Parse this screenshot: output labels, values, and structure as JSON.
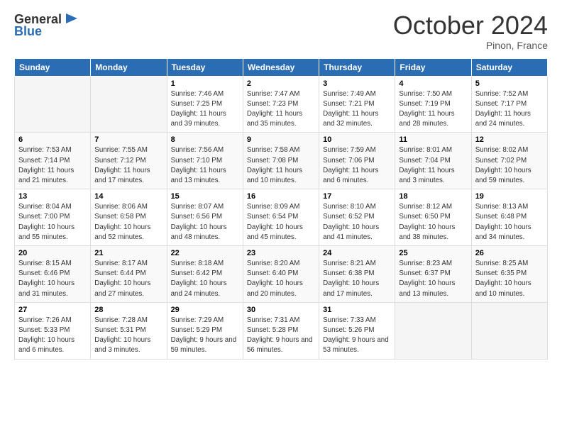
{
  "header": {
    "logo_general": "General",
    "logo_blue": "Blue",
    "month_title": "October 2024",
    "location": "Pinon, France"
  },
  "days_of_week": [
    "Sunday",
    "Monday",
    "Tuesday",
    "Wednesday",
    "Thursday",
    "Friday",
    "Saturday"
  ],
  "weeks": [
    [
      {
        "day": "",
        "info": ""
      },
      {
        "day": "",
        "info": ""
      },
      {
        "day": "1",
        "info": "Sunrise: 7:46 AM\nSunset: 7:25 PM\nDaylight: 11 hours and 39 minutes."
      },
      {
        "day": "2",
        "info": "Sunrise: 7:47 AM\nSunset: 7:23 PM\nDaylight: 11 hours and 35 minutes."
      },
      {
        "day": "3",
        "info": "Sunrise: 7:49 AM\nSunset: 7:21 PM\nDaylight: 11 hours and 32 minutes."
      },
      {
        "day": "4",
        "info": "Sunrise: 7:50 AM\nSunset: 7:19 PM\nDaylight: 11 hours and 28 minutes."
      },
      {
        "day": "5",
        "info": "Sunrise: 7:52 AM\nSunset: 7:17 PM\nDaylight: 11 hours and 24 minutes."
      }
    ],
    [
      {
        "day": "6",
        "info": "Sunrise: 7:53 AM\nSunset: 7:14 PM\nDaylight: 11 hours and 21 minutes."
      },
      {
        "day": "7",
        "info": "Sunrise: 7:55 AM\nSunset: 7:12 PM\nDaylight: 11 hours and 17 minutes."
      },
      {
        "day": "8",
        "info": "Sunrise: 7:56 AM\nSunset: 7:10 PM\nDaylight: 11 hours and 13 minutes."
      },
      {
        "day": "9",
        "info": "Sunrise: 7:58 AM\nSunset: 7:08 PM\nDaylight: 11 hours and 10 minutes."
      },
      {
        "day": "10",
        "info": "Sunrise: 7:59 AM\nSunset: 7:06 PM\nDaylight: 11 hours and 6 minutes."
      },
      {
        "day": "11",
        "info": "Sunrise: 8:01 AM\nSunset: 7:04 PM\nDaylight: 11 hours and 3 minutes."
      },
      {
        "day": "12",
        "info": "Sunrise: 8:02 AM\nSunset: 7:02 PM\nDaylight: 10 hours and 59 minutes."
      }
    ],
    [
      {
        "day": "13",
        "info": "Sunrise: 8:04 AM\nSunset: 7:00 PM\nDaylight: 10 hours and 55 minutes."
      },
      {
        "day": "14",
        "info": "Sunrise: 8:06 AM\nSunset: 6:58 PM\nDaylight: 10 hours and 52 minutes."
      },
      {
        "day": "15",
        "info": "Sunrise: 8:07 AM\nSunset: 6:56 PM\nDaylight: 10 hours and 48 minutes."
      },
      {
        "day": "16",
        "info": "Sunrise: 8:09 AM\nSunset: 6:54 PM\nDaylight: 10 hours and 45 minutes."
      },
      {
        "day": "17",
        "info": "Sunrise: 8:10 AM\nSunset: 6:52 PM\nDaylight: 10 hours and 41 minutes."
      },
      {
        "day": "18",
        "info": "Sunrise: 8:12 AM\nSunset: 6:50 PM\nDaylight: 10 hours and 38 minutes."
      },
      {
        "day": "19",
        "info": "Sunrise: 8:13 AM\nSunset: 6:48 PM\nDaylight: 10 hours and 34 minutes."
      }
    ],
    [
      {
        "day": "20",
        "info": "Sunrise: 8:15 AM\nSunset: 6:46 PM\nDaylight: 10 hours and 31 minutes."
      },
      {
        "day": "21",
        "info": "Sunrise: 8:17 AM\nSunset: 6:44 PM\nDaylight: 10 hours and 27 minutes."
      },
      {
        "day": "22",
        "info": "Sunrise: 8:18 AM\nSunset: 6:42 PM\nDaylight: 10 hours and 24 minutes."
      },
      {
        "day": "23",
        "info": "Sunrise: 8:20 AM\nSunset: 6:40 PM\nDaylight: 10 hours and 20 minutes."
      },
      {
        "day": "24",
        "info": "Sunrise: 8:21 AM\nSunset: 6:38 PM\nDaylight: 10 hours and 17 minutes."
      },
      {
        "day": "25",
        "info": "Sunrise: 8:23 AM\nSunset: 6:37 PM\nDaylight: 10 hours and 13 minutes."
      },
      {
        "day": "26",
        "info": "Sunrise: 8:25 AM\nSunset: 6:35 PM\nDaylight: 10 hours and 10 minutes."
      }
    ],
    [
      {
        "day": "27",
        "info": "Sunrise: 7:26 AM\nSunset: 5:33 PM\nDaylight: 10 hours and 6 minutes."
      },
      {
        "day": "28",
        "info": "Sunrise: 7:28 AM\nSunset: 5:31 PM\nDaylight: 10 hours and 3 minutes."
      },
      {
        "day": "29",
        "info": "Sunrise: 7:29 AM\nSunset: 5:29 PM\nDaylight: 9 hours and 59 minutes."
      },
      {
        "day": "30",
        "info": "Sunrise: 7:31 AM\nSunset: 5:28 PM\nDaylight: 9 hours and 56 minutes."
      },
      {
        "day": "31",
        "info": "Sunrise: 7:33 AM\nSunset: 5:26 PM\nDaylight: 9 hours and 53 minutes."
      },
      {
        "day": "",
        "info": ""
      },
      {
        "day": "",
        "info": ""
      }
    ]
  ]
}
